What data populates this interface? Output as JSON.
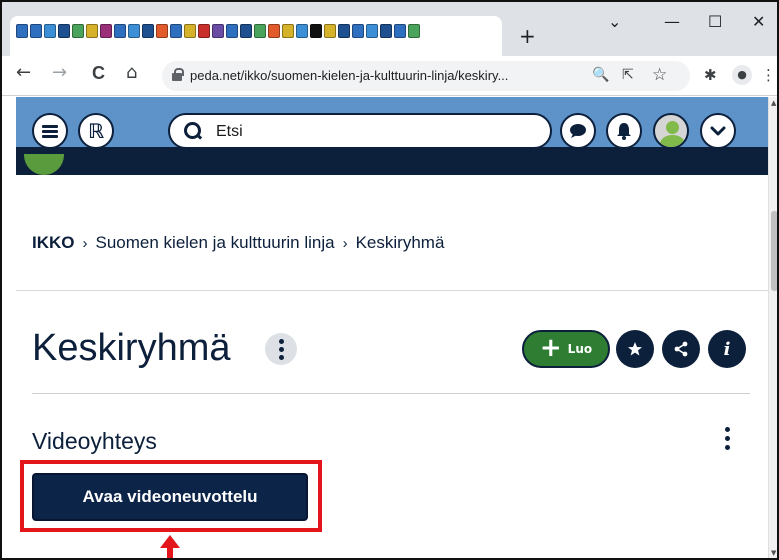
{
  "browser": {
    "tab_favicon_colors": [
      "#2f6fbf",
      "#2f6fbf",
      "#3c8fd6",
      "#1e4f8f",
      "#4aa35a",
      "#d6b12a",
      "#9a2f7a",
      "#2f6fbf",
      "#3c8fd6",
      "#1e4f8f",
      "#e05a2b",
      "#2f6fbf",
      "#d6b12a",
      "#c9302c",
      "#6b4ca5",
      "#2f6fbf",
      "#1e4f8f",
      "#4aa35a",
      "#e05a2b",
      "#d6b12a",
      "#3c8fd6",
      "#111111",
      "#d6b12a",
      "#1e4f8f",
      "#2f6fbf",
      "#3c8fd6",
      "#1e4f8f",
      "#2f6fbf",
      "#4aa35a"
    ],
    "new_tab": "+",
    "window_controls": {
      "dropdown": "⌄",
      "minimize": "—",
      "maximize": "☐",
      "close": "✕"
    },
    "url": "peda.net/ikko/suomen-kielen-ja-kulttuurin-linja/keskiry...",
    "nav": {
      "back": "←",
      "forward": "→",
      "reload": "C",
      "home": "⌂"
    },
    "omni_icons": {
      "zoom": "🔍",
      "share": "⇱",
      "bookmark": "☆"
    },
    "toolbar_icons": {
      "extensions": "✱",
      "profile": "●",
      "menu": "⋮"
    }
  },
  "site_header": {
    "search_placeholder": "Etsi",
    "colors": {
      "primary": "#0c1f3b",
      "header_bg": "#5d93c9",
      "avatar": "#7fba4a"
    }
  },
  "breadcrumb": {
    "items": [
      "IKKO",
      "Suomen kielen ja kulttuurin linja",
      "Keskiryhmä"
    ],
    "separator": "›"
  },
  "page": {
    "title": "Keskiryhmä",
    "create_button": "Luo",
    "section_title": "Videoyhteys",
    "video_button": "Avaa videoneuvottelu"
  },
  "annotation": {
    "highlight_color": "#e3161b"
  }
}
